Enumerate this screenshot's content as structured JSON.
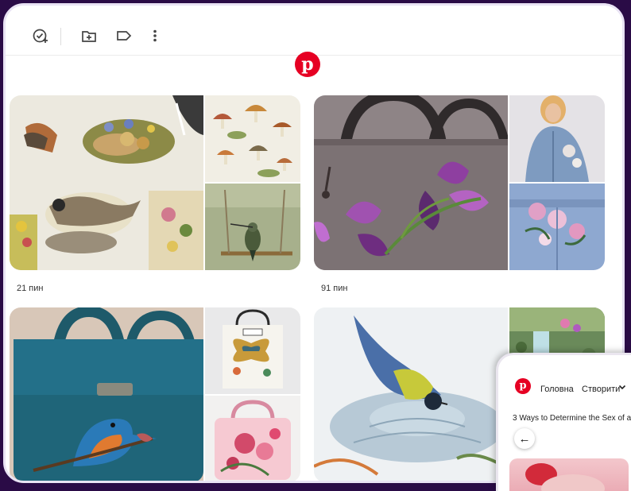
{
  "toolbar": {
    "icons": [
      "check-plus-icon",
      "folder-add-icon",
      "label-icon",
      "more-vert-icon"
    ]
  },
  "logo": {
    "glyph": "p",
    "brand_color": "#e60023"
  },
  "boards": [
    {
      "pin_count": "21 пин"
    },
    {
      "pin_count": "91 пин"
    }
  ],
  "popup": {
    "nav": [
      "Головна",
      "Створити"
    ],
    "article_title": "3 Ways to Determine the Sex of a",
    "back_glyph": "←"
  }
}
